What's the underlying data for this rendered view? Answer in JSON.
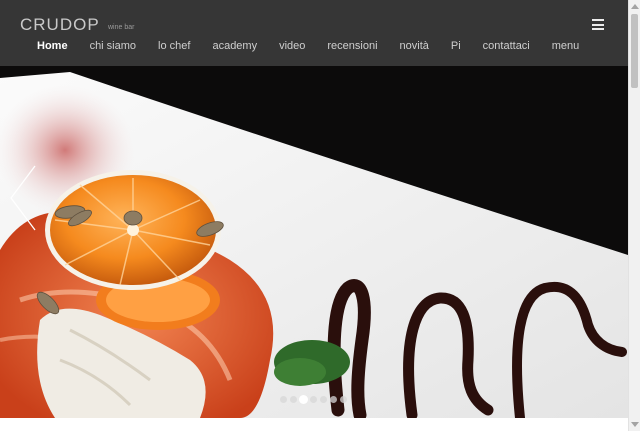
{
  "brand": {
    "name": "CRUDOP",
    "subtitle": "wine bar"
  },
  "nav": {
    "items": [
      {
        "label": "Home",
        "active": true
      },
      {
        "label": "chi siamo"
      },
      {
        "label": "lo chef"
      },
      {
        "label": "academy"
      },
      {
        "label": "video"
      },
      {
        "label": "recensioni"
      },
      {
        "label": "novità"
      },
      {
        "label": "Pi"
      },
      {
        "label": "contattaci"
      },
      {
        "label": "menu"
      }
    ]
  },
  "slider": {
    "slide_count": 7,
    "active_index": 2,
    "image": "salmon-tartare-with-orange-slice"
  },
  "icons": {
    "menu": "hamburger-icon",
    "prev": "chevron-left-icon"
  },
  "colors": {
    "header_bg": "#3a3a3a",
    "nav_text": "#cfcfcf",
    "active_nav": "#ffffff"
  }
}
